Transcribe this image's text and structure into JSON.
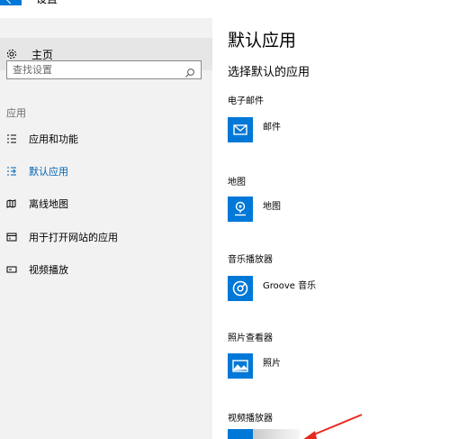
{
  "window": {
    "title": "设置"
  },
  "sidebar": {
    "home_label": "主页",
    "search_placeholder": "查找设置",
    "section_label": "应用",
    "items": [
      {
        "label": "应用和功能",
        "icon": "list-icon",
        "active": false
      },
      {
        "label": "默认应用",
        "icon": "default-apps-icon",
        "active": true
      },
      {
        "label": "离线地图",
        "icon": "offline-map-icon",
        "active": false
      },
      {
        "label": "用于打开网站的应用",
        "icon": "web-apps-icon",
        "active": false
      },
      {
        "label": "视频播放",
        "icon": "video-icon",
        "active": false
      }
    ]
  },
  "main": {
    "title": "默认应用",
    "subtitle": "选择默认的应用",
    "groups": [
      {
        "label": "电子邮件",
        "app": "邮件",
        "icon": "mail-icon"
      },
      {
        "label": "地图",
        "app": "地图",
        "icon": "map-pin-icon"
      },
      {
        "label": "音乐播放器",
        "app": "Groove 音乐",
        "icon": "groove-music-icon"
      },
      {
        "label": "照片查看器",
        "app": "照片",
        "icon": "photos-icon"
      },
      {
        "label": "视频播放器",
        "app": "",
        "icon": "video-player-icon"
      }
    ]
  },
  "colors": {
    "accent": "#0078d7",
    "active_text": "#0063b1",
    "sidebar_bg": "#f2f2f2",
    "annotation_arrow": "#e8291c"
  }
}
